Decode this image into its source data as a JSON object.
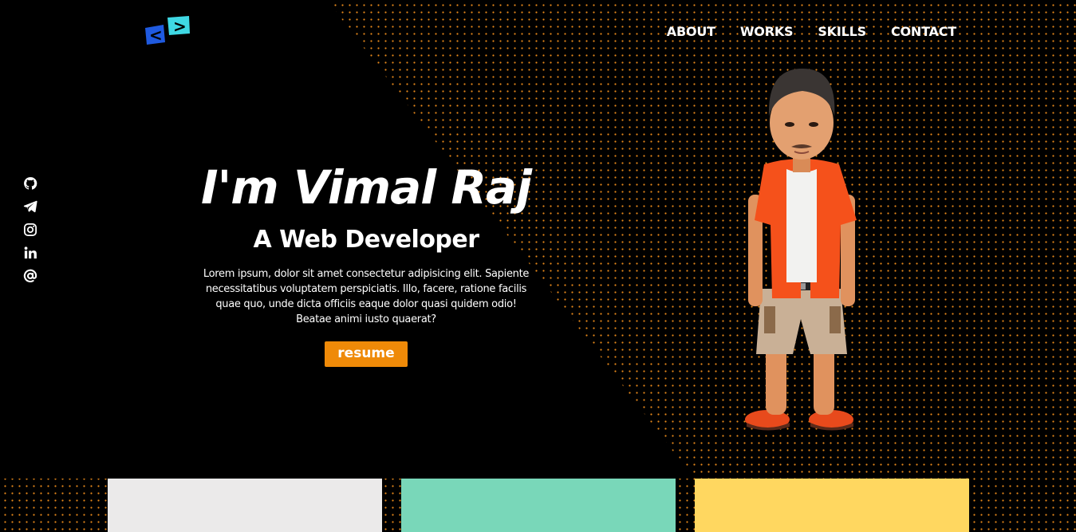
{
  "logo": {
    "icon": "code-brackets-icon",
    "left_color": "#1f5ae0",
    "right_color": "#3fd8e4",
    "left_glyph": "<",
    "right_glyph": ">"
  },
  "nav": {
    "items": [
      {
        "label": "ABOUT"
      },
      {
        "label": "WORKS"
      },
      {
        "label": "SKILLS"
      },
      {
        "label": "CONTACT"
      }
    ]
  },
  "social": {
    "icons": [
      "github-icon",
      "telegram-icon",
      "instagram-icon",
      "linkedin-icon",
      "email-at-icon"
    ]
  },
  "hero": {
    "title": "I'm Vimal Raj",
    "subtitle": "A Web Developer",
    "description": "Lorem ipsum, dolor sit amet consectetur adipisicing elit. Sapiente necessitatibus voluptatem perspiciatis. Illo, facere, ratione facilis quae quo, unde dicta officiis eaque dolor quasi quidem odio! Beatae animi iusto quaerat?",
    "resume_label": "resume"
  },
  "colors": {
    "background": "#000000",
    "dot_pattern": "#e8891a",
    "button": "#ef8a08",
    "card_1": "#ebeaea",
    "card_2": "#79d7b9",
    "card_3": "#ffd760"
  }
}
